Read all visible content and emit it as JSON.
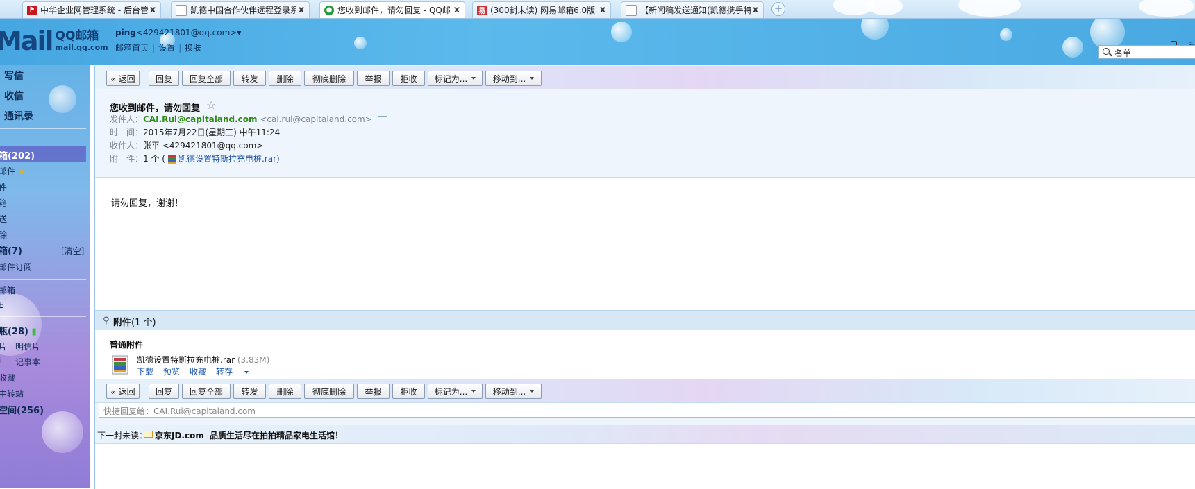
{
  "browser": {
    "tabs": [
      {
        "title": "中华企业网管理系统 - 后台管",
        "icon": "red-flag-favicon-icon",
        "active": false
      },
      {
        "title": "凯德中国合作伙伴远程登录系",
        "icon": "page-favicon-icon",
        "active": false
      },
      {
        "title": "您收到邮件，请勿回复 - QQ邮",
        "icon": "qq-favicon-icon",
        "active": true
      },
      {
        "title": "(300封未读) 网易邮箱6.0版",
        "icon": "netease-favicon-icon",
        "active": false
      },
      {
        "title": "【新闻稿发送通知(凯德携手特",
        "icon": "page-favicon-icon",
        "active": false
      }
    ],
    "close_glyph": "x",
    "newtab_glyph": "+"
  },
  "header": {
    "logo_big": "Mail",
    "logo_name": "QQ邮箱",
    "logo_domain": "mail.qq.com",
    "account_name": "ping",
    "account_email": "<429421801@qq.com>",
    "account_caret": "▾",
    "links": [
      "邮箱首页",
      "设置",
      "换肤"
    ],
    "link_sep": "|",
    "feedback_label": "反",
    "search_value": "名单"
  },
  "sidebar": {
    "primary": [
      "写信",
      "收信",
      "通讯录"
    ],
    "inbox_label": "箱(202)",
    "items": [
      "邮件",
      "件",
      "箱",
      "送",
      "除"
    ],
    "trash_label": "箱(7)",
    "trash_clear": "[清空]",
    "subscriptions": "邮件订阅",
    "other_mailbox": "邮箱",
    "other_2": "E",
    "bottle_label": "瓶(28)",
    "postcard_1": "片",
    "postcard_2": "明信片",
    "notes_1": "i",
    "notes_2": "记事本",
    "favorites": "收藏",
    "transfer": "中转站",
    "space": "空间(256)"
  },
  "toolbar": {
    "back": "« 返回",
    "reply": "回复",
    "reply_all": "回复全部",
    "forward": "转发",
    "delete": "删除",
    "perm_delete": "彻底删除",
    "report": "举报",
    "reject": "拒收",
    "mark_as": "标记为...",
    "move_to": "移动到..."
  },
  "mail": {
    "subject": "您收到邮件，请勿回复",
    "star": "☆",
    "sender_label": "发件人：",
    "sender_name": "CAI.Rui@capitaland.com",
    "sender_addr": "<cai.rui@capitaland.com>",
    "time_label": "时　间：",
    "time_value": "2015年7月22日(星期三) 中午11:24",
    "to_label": "收件人：",
    "to_value": "张平 <429421801@qq.com>",
    "att_label": "附　件：",
    "att_count": "1 个 (",
    "att_file": "凯德设置特斯拉充电桩.rar",
    "att_close": ")",
    "body": "请勿回复，谢谢！"
  },
  "attachments": {
    "header_bold": "附件",
    "header_count": "(1 个)",
    "section": "普通附件",
    "file_name": "凯德设置特斯拉充电桩.rar",
    "file_size": "(3.83M)",
    "actions": [
      "下载",
      "预览",
      "收藏",
      "转存"
    ]
  },
  "quick_reply": {
    "placeholder": "快捷回复给：CAI.Rui@capitaland.com"
  },
  "next_unread": {
    "label": "下一封未读：",
    "from": "京东JD.com",
    "subject": "品质生活尽在拍拍精品家电生活馆！"
  },
  "colors": {
    "header_blue": "#4aa9e2",
    "sender_green": "#2f8b17",
    "link_blue": "#1a55a8",
    "sidebar_purple": "#8f7cd6"
  }
}
